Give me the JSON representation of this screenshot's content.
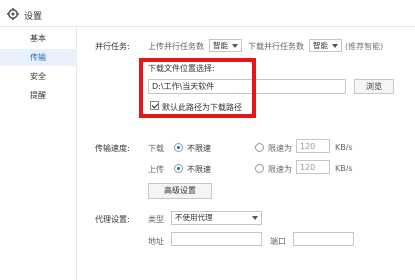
{
  "window": {
    "title": "设置"
  },
  "sidebar": {
    "items": [
      {
        "label": "基本"
      },
      {
        "label": "传输",
        "active": true
      },
      {
        "label": "安全"
      },
      {
        "label": "提醒"
      }
    ]
  },
  "parallel": {
    "label": "并行任务:",
    "upload_label": "上传并行任务数",
    "upload_value": "智能",
    "download_label": "下载并行任务数",
    "download_value": "智能",
    "hint": "(推荐智能)"
  },
  "download_location": {
    "label": "下载文件位置选择:",
    "path": "D:\\工作\\当天软件",
    "browse_label": "浏览",
    "default_checkbox_label": "默认此路径为下载路径",
    "default_checked": true
  },
  "speed": {
    "label": "传输速度:",
    "download": {
      "label": "下载",
      "unlimited": "不限速",
      "limit_label": "限速为",
      "limit_value": "120",
      "unit": "KB/s",
      "selected": "unlimited"
    },
    "upload": {
      "label": "上传",
      "unlimited": "不限速",
      "limit_label": "限速为",
      "limit_value": "120",
      "unit": "KB/s",
      "selected": "unlimited"
    },
    "advanced_label": "高级设置"
  },
  "proxy": {
    "label": "代理设置:",
    "type_label": "类型",
    "type_value": "不使用代理",
    "address_label": "地址",
    "address_value": "",
    "port_label": "端口",
    "port_value": ""
  },
  "colors": {
    "highlight_frame": "#e8161b",
    "accent": "#1a6fbf",
    "active_bg": "#e8f1fb"
  }
}
